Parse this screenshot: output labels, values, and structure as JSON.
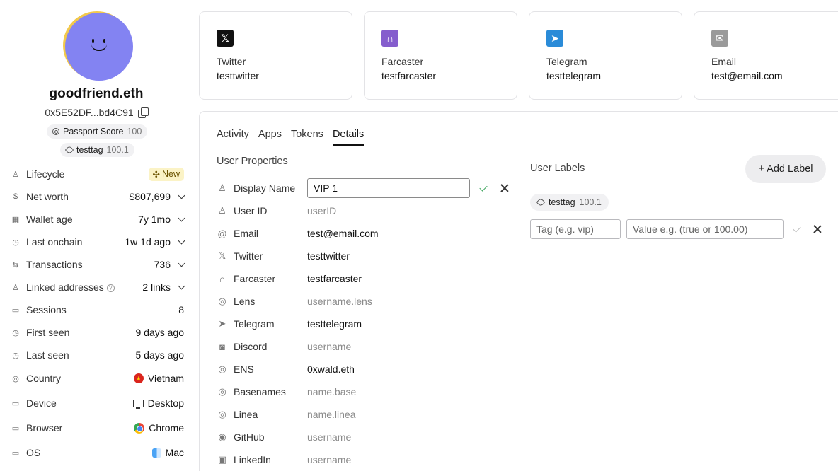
{
  "profile": {
    "ens_name": "goodfriend.eth",
    "address": "0x5E52DF...bd4C91",
    "passport_label": "Passport Score",
    "passport_score": "100",
    "tag_name": "testtag",
    "tag_value": "100.1"
  },
  "properties": [
    {
      "label": "Lifecycle",
      "value": "New",
      "icon": "lifecycle-icon"
    },
    {
      "label": "Net worth",
      "value": "$807,699",
      "icon": "dollar-icon"
    },
    {
      "label": "Wallet age",
      "value": "7y 1mo",
      "icon": "calendar-icon"
    },
    {
      "label": "Last onchain",
      "value": "1w 1d ago",
      "icon": "clock-icon"
    },
    {
      "label": "Transactions",
      "value": "736",
      "icon": "transfer-icon"
    },
    {
      "label": "Linked addresses",
      "value": "2 links",
      "icon": "user-icon"
    },
    {
      "label": "Sessions",
      "value": "8",
      "icon": "monitor-icon"
    },
    {
      "label": "First seen",
      "value": "9 days ago",
      "icon": "clock-icon"
    },
    {
      "label": "Last seen",
      "value": "5 days ago",
      "icon": "clock-icon"
    },
    {
      "label": "Country",
      "value": "Vietnam",
      "icon": "globe-icon"
    },
    {
      "label": "Device",
      "value": "Desktop",
      "icon": "device-icon"
    },
    {
      "label": "Browser",
      "value": "Chrome",
      "icon": "browser-icon"
    },
    {
      "label": "OS",
      "value": "Mac",
      "icon": "os-icon"
    }
  ],
  "cards": [
    {
      "title": "Twitter",
      "value": "testtwitter",
      "icon": "x-logo-icon",
      "color": "#111111"
    },
    {
      "title": "Farcaster",
      "value": "testfarcaster",
      "icon": "farcaster-logo-icon",
      "color": "#855dcd"
    },
    {
      "title": "Telegram",
      "value": "testtelegram",
      "icon": "telegram-logo-icon",
      "color": "#2a8bd8"
    },
    {
      "title": "Email",
      "value": "test@email.com",
      "icon": "email-logo-icon",
      "color": "#9a9a9a"
    }
  ],
  "tabs": [
    "Activity",
    "Apps",
    "Tokens",
    "Details"
  ],
  "active_tab": "Details",
  "user_properties": {
    "title": "User Properties",
    "display_name_label": "Display Name",
    "display_name_value": "VIP 1",
    "fields": [
      {
        "label": "User ID",
        "value": "userID",
        "placeholder": true,
        "icon": "user-icon"
      },
      {
        "label": "Email",
        "value": "test@email.com",
        "placeholder": false,
        "icon": "at-icon"
      },
      {
        "label": "Twitter",
        "value": "testtwitter",
        "placeholder": false,
        "icon": "x-icon"
      },
      {
        "label": "Farcaster",
        "value": "testfarcaster",
        "placeholder": false,
        "icon": "farcaster-icon"
      },
      {
        "label": "Lens",
        "value": "username.lens",
        "placeholder": true,
        "icon": "globe-icon"
      },
      {
        "label": "Telegram",
        "value": "testtelegram",
        "placeholder": false,
        "icon": "telegram-icon"
      },
      {
        "label": "Discord",
        "value": "username",
        "placeholder": true,
        "icon": "discord-icon"
      },
      {
        "label": "ENS",
        "value": "0xwald.eth",
        "placeholder": false,
        "icon": "globe-icon"
      },
      {
        "label": "Basenames",
        "value": "name.base",
        "placeholder": true,
        "icon": "globe-icon"
      },
      {
        "label": "Linea",
        "value": "name.linea",
        "placeholder": true,
        "icon": "globe-icon"
      },
      {
        "label": "GitHub",
        "value": "username",
        "placeholder": true,
        "icon": "github-icon"
      },
      {
        "label": "LinkedIn",
        "value": "username",
        "placeholder": true,
        "icon": "linkedin-icon"
      }
    ]
  },
  "user_labels": {
    "title": "User Labels",
    "add_label": "+ Add Label",
    "tag_name": "testtag",
    "tag_value": "100.1",
    "tag_placeholder": "Tag (e.g. vip)",
    "value_placeholder": "Value e.g. (true or 100.00)"
  },
  "colors": {
    "avatar": "#8383f2",
    "avatar_ring": "#f2c94c",
    "new_badge_bg": "#fbf3c6",
    "confirm_green": "#3aa35a"
  }
}
